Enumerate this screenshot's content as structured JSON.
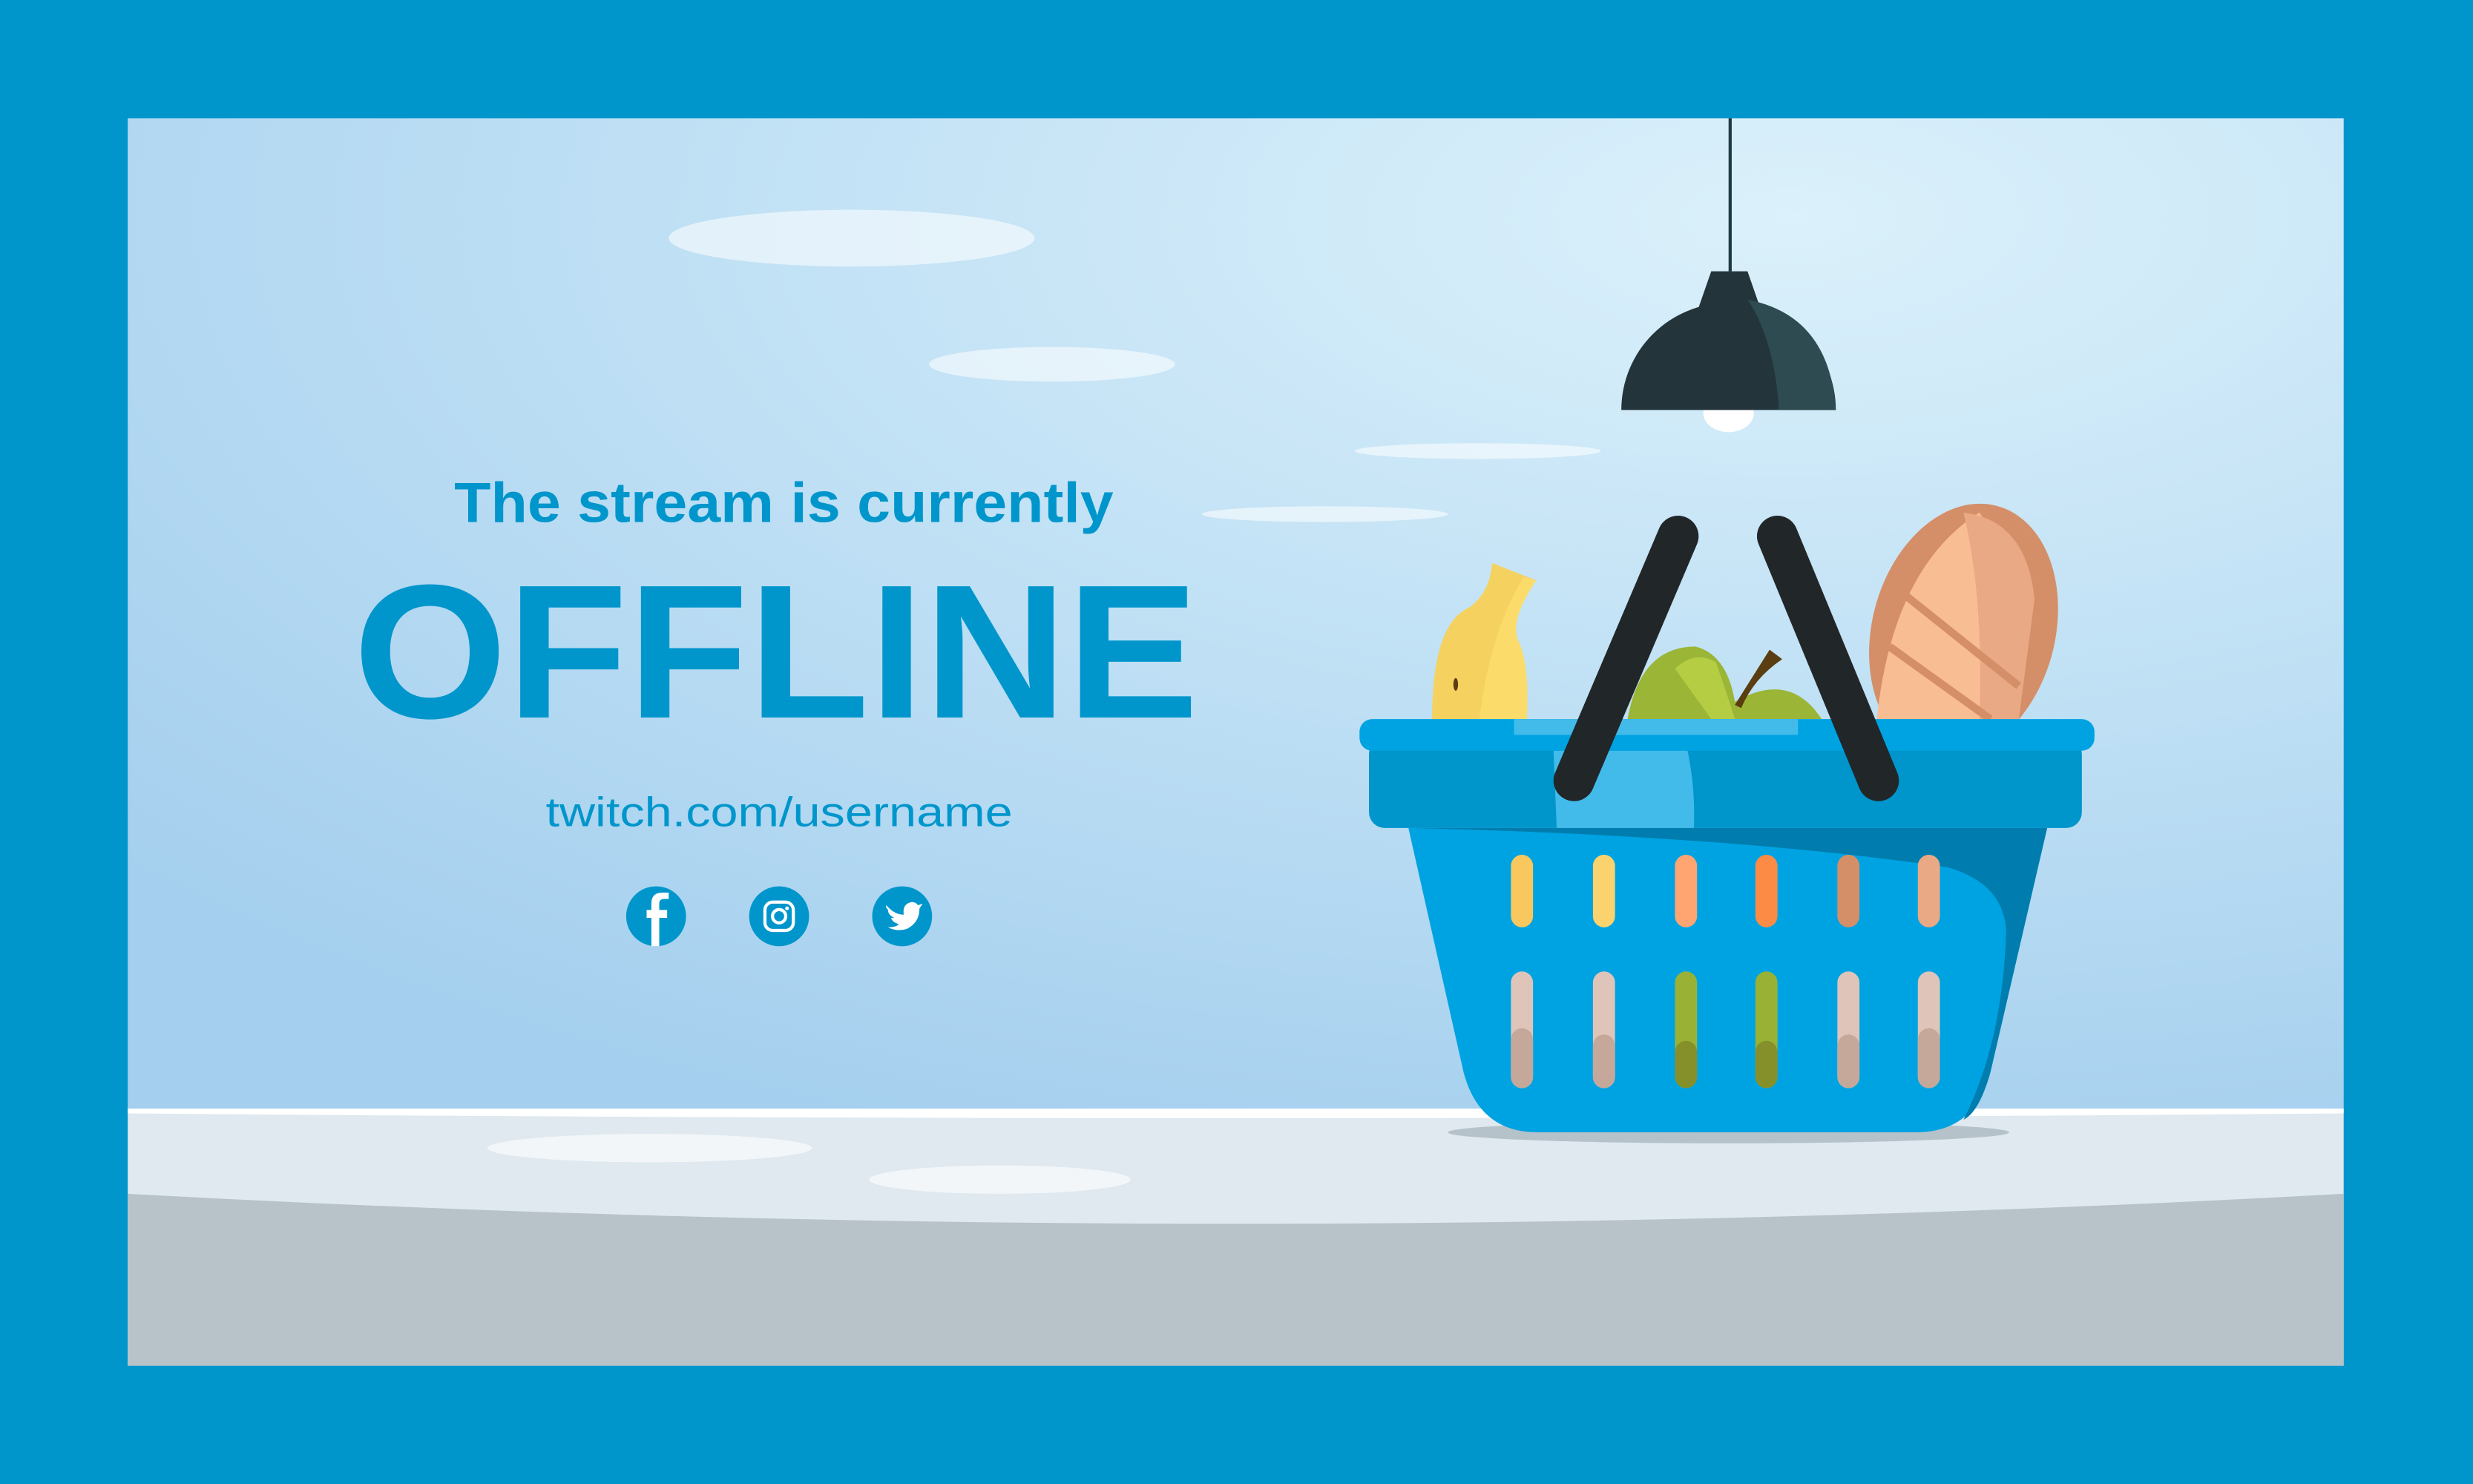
{
  "headline": {
    "subtitle": "The stream is currently",
    "status": "OFFLINE",
    "channel_url": "twitch.com/username"
  },
  "social_links": [
    {
      "name": "facebook",
      "icon": "facebook-icon"
    },
    {
      "name": "instagram",
      "icon": "instagram-icon"
    },
    {
      "name": "twitter",
      "icon": "twitter-icon"
    }
  ],
  "colors": {
    "frame": "#0096cc",
    "text": "#0096cc",
    "basket": "#00a3e2",
    "floor": "#dfe9ef",
    "wall_light": "#daf0fa",
    "wall_dark": "#a6d0ee"
  }
}
